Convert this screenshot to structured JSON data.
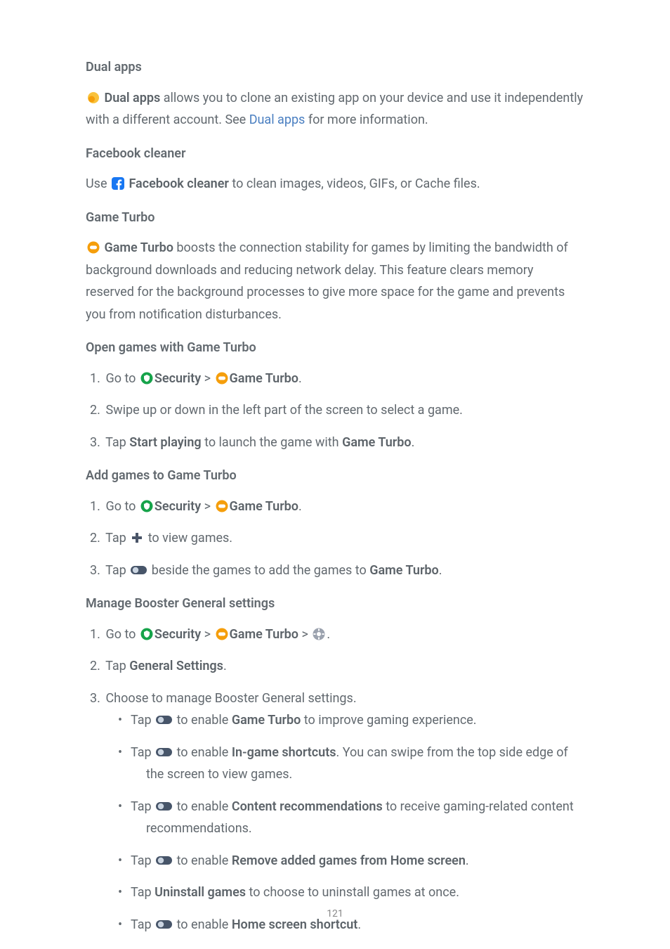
{
  "sections": {
    "dual_apps": {
      "heading": "Dual apps",
      "bold": "Dual apps",
      "text1": " allows you to clone an existing app on your device and use it inde­pendently with a different account. See ",
      "link": "Dual apps",
      "text2": " for more information."
    },
    "facebook_cleaner": {
      "heading": "Facebook cleaner",
      "text1": "Use ",
      "bold": "Facebook cleaner",
      "text2": " to clean images, videos, GIFs, or Cache files."
    },
    "game_turbo": {
      "heading": "Game Turbo",
      "bold": "Game Turbo",
      "text": " boosts the connection stability for games by limiting the band­width of background downloads and reducing network delay. This feature clears memory reserved for the background processes to give more space for the game and prevents you from notification disturbances."
    },
    "open_games": {
      "heading": "Open games with Game Turbo",
      "step1_a": "Go to ",
      "step1_sec": "Security",
      "step1_gt": " > ",
      "step1_gt2": "Game Turbo",
      "step1_end": ".",
      "step2": "Swipe up or down in the left part of the screen to select a game.",
      "step3_a": "Tap ",
      "step3_b": "Start playing",
      "step3_c": " to launch the game with ",
      "step3_d": "Game Turbo",
      "step3_e": "."
    },
    "add_games": {
      "heading": "Add games to Game Turbo",
      "step1_a": "Go to ",
      "step1_sec": "Security",
      "step1_gt": " > ",
      "step1_gt2": "Game Turbo",
      "step1_end": ".",
      "step2_a": "Tap ",
      "step2_b": " to view games.",
      "step3_a": "Tap ",
      "step3_b": " beside the games to add the games to ",
      "step3_c": "Game Turbo",
      "step3_d": "."
    },
    "manage": {
      "heading": "Manage Booster General settings",
      "step1_a": "Go to ",
      "step1_sec": "Security",
      "step1_gt": " > ",
      "step1_gt2": "Game Turbo",
      "step1_gt3": " > ",
      "step1_end": ".",
      "step2_a": "Tap ",
      "step2_b": "General Settings",
      "step2_c": ".",
      "step3": "Choose to manage Booster General settings.",
      "b1_a": "Tap ",
      "b1_b": " to enable ",
      "b1_c": "Game Turbo",
      "b1_d": " to improve gaming experience.",
      "b2_a": "Tap ",
      "b2_b": " to enable ",
      "b2_c": "In-game shortcuts",
      "b2_d": ". You can swipe from the top side edge of the screen to view games.",
      "b3_a": "Tap ",
      "b3_b": " to enable ",
      "b3_c": "Content recommendations",
      "b3_d": " to receive gaming-related content recommendations.",
      "b4_a": "Tap ",
      "b4_b": " to enable ",
      "b4_c": "Remove added games from Home screen",
      "b4_d": ".",
      "b5_a": "Tap ",
      "b5_b": "Uninstall games",
      "b5_c": " to choose to uninstall games at once.",
      "b6_a": "Tap ",
      "b6_b": " to enable ",
      "b6_c": "Home screen shortcut",
      "b6_d": "."
    }
  },
  "page_number": "121"
}
